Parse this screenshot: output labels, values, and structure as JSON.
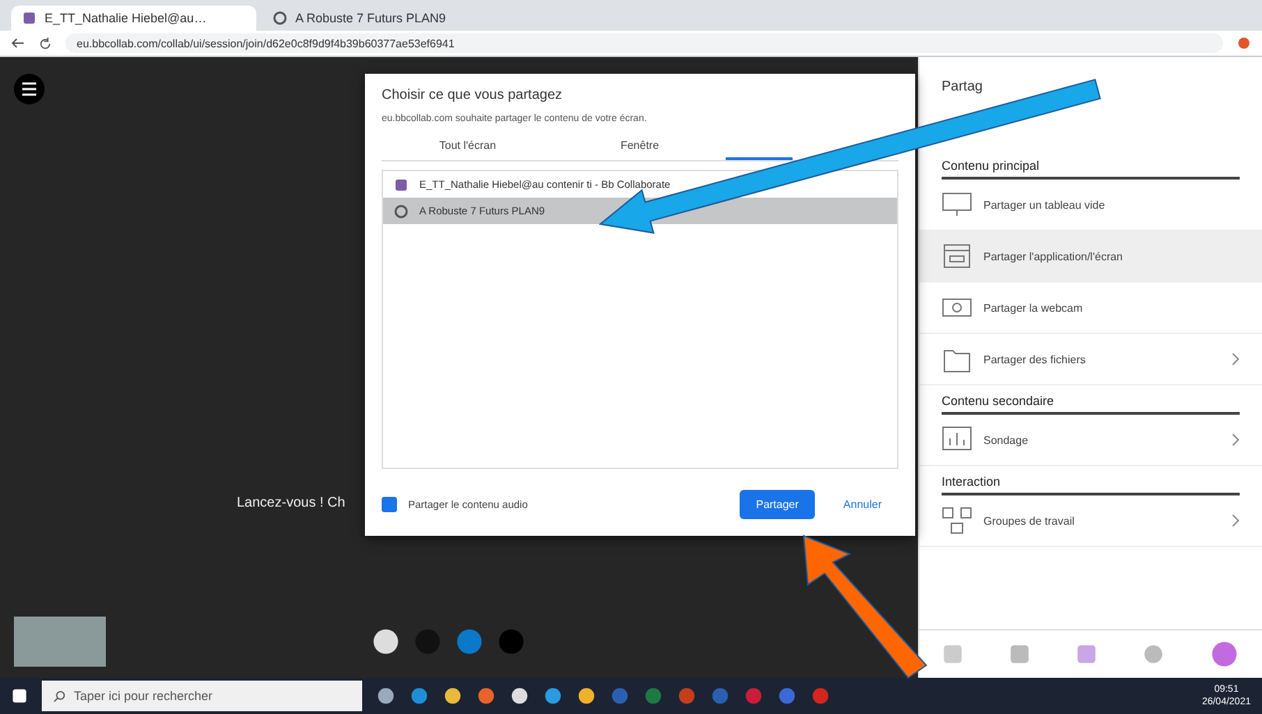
{
  "browser": {
    "tabs": [
      {
        "title": "E_TT_Nathalie Hiebel@au…",
        "selected": true,
        "kind": "collab"
      },
      {
        "title": "A Robuste 7 Futurs PLAN9",
        "selected": false,
        "kind": "web"
      }
    ],
    "url": "eu.bbcollab.com/collab/ui/session/join/d62e0c8f9d9f4b39b60377ae53ef6941"
  },
  "stage": {
    "message": "Lancez-vous ! Ch"
  },
  "dialog": {
    "title": "Choisir ce que vous partagez",
    "subtitle": "eu.bbcollab.com souhaite partager le contenu de votre écran.",
    "tabs": [
      {
        "label": "Tout l'écran",
        "selected": false
      },
      {
        "label": "Fenêtre",
        "selected": false
      },
      {
        "selected": true
      }
    ],
    "sources": [
      {
        "title": "E_TT_Nathalie Hiebel@au contenir ti - Bb Collaborate",
        "selected": false,
        "kind": "collab"
      },
      {
        "title": "A Robuste 7 Futurs PLAN9",
        "selected": true,
        "kind": "web"
      }
    ],
    "audio": {
      "label": "Partager le contenu audio",
      "checked": true
    },
    "buttons": [
      {
        "label": "Partager",
        "kind": "primary"
      },
      {
        "label": "Annuler",
        "kind": "secondary"
      }
    ]
  },
  "panel": {
    "title": "Partag",
    "sections": [
      {
        "heading": "Contenu principal",
        "items": [
          {
            "label": "Partager un tableau vide",
            "selected": false,
            "submenu": false
          },
          {
            "label": "Partager l'application/l'écran",
            "selected": true,
            "submenu": false
          },
          {
            "label": "Partager la webcam",
            "selected": false,
            "submenu": false
          },
          {
            "label": "Partager des fichiers",
            "selected": false,
            "submenu": true
          }
        ]
      },
      {
        "heading": "Contenu secondaire",
        "items": [
          {
            "label": "Sondage",
            "selected": false,
            "submenu": true
          }
        ]
      },
      {
        "heading": "Interaction",
        "items": [
          {
            "label": "Groupes de travail",
            "selected": false,
            "submenu": true
          }
        ]
      }
    ]
  },
  "taskbar": {
    "search_placeholder": "Taper ici pour rechercher",
    "time": "09:51",
    "date": "26/04/2021"
  }
}
